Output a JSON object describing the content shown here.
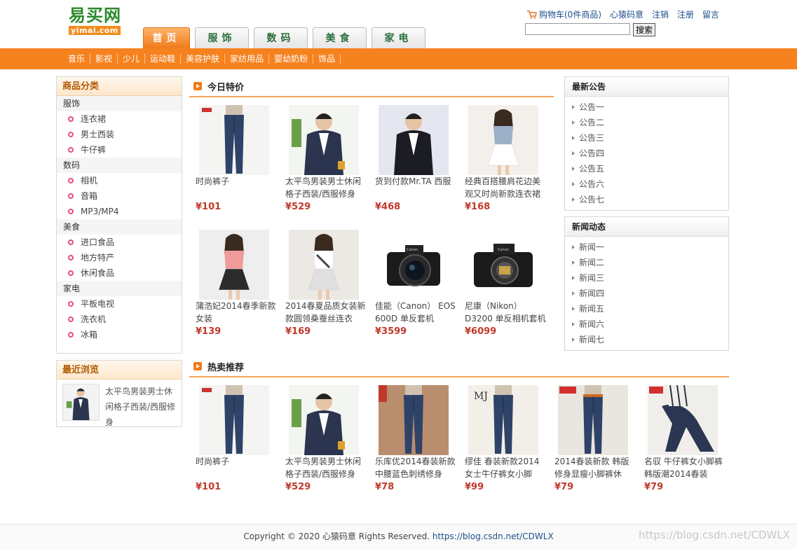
{
  "logo": {
    "cn": "易买网",
    "en": "yimai.com"
  },
  "top_links": {
    "cart": "购物车(0件商品)",
    "user": "心猿码意",
    "logout": "注销",
    "register": "注册",
    "message": "留言"
  },
  "search": {
    "button": "搜索",
    "placeholder": ""
  },
  "main_tabs": [
    "首页",
    "服饰",
    "数码",
    "美食",
    "家电"
  ],
  "subnav": [
    "音乐",
    "影视",
    "少儿",
    "运动鞋",
    "美容护肤",
    "家纺用品",
    "婴幼奶粉",
    "饰品"
  ],
  "categories": {
    "title": "商品分类",
    "groups": [
      {
        "name": "服饰",
        "items": [
          "连衣裙",
          "男士西装",
          "牛仔裤"
        ]
      },
      {
        "name": "数码",
        "items": [
          "相机",
          "音箱",
          "MP3/MP4"
        ]
      },
      {
        "name": "美食",
        "items": [
          "进口食品",
          "地方特产",
          "休闲食品"
        ]
      },
      {
        "name": "家电",
        "items": [
          "平板电视",
          "洗衣机",
          "冰箱"
        ]
      }
    ]
  },
  "recent": {
    "title": "最近浏览",
    "item": "太平鸟男装男士休闲格子西装/西服修身"
  },
  "specials": {
    "title": "今日特价",
    "products": [
      {
        "name": "时尚裤子",
        "price": "¥101",
        "img": "jeans"
      },
      {
        "name": "太平鸟男装男士休闲格子西装/西服修身",
        "price": "¥529",
        "img": "suit"
      },
      {
        "name": "货到付款Mr.TA 西服",
        "price": "¥468",
        "img": "suit-dark"
      },
      {
        "name": "经典百搭腰肩花边美观又时尚新款连衣裙",
        "price": "¥168",
        "img": "dress"
      },
      {
        "name": "蒲浩妃2014春季新款女装",
        "price": "¥139",
        "img": "woman-pink"
      },
      {
        "name": "2014春夏品质女装新款圆领桑蚕丝连衣",
        "price": "¥169",
        "img": "woman-white"
      },
      {
        "name": "佳能（Canon） EOS 600D 单反套机",
        "price": "¥3599",
        "img": "camera-lens"
      },
      {
        "name": "尼康（Nikon） D3200 单反相机套机",
        "price": "¥6099",
        "img": "camera-body"
      }
    ]
  },
  "hot": {
    "title": "热卖推荐",
    "products": [
      {
        "name": "时尚裤子",
        "price": "¥101",
        "img": "jeans"
      },
      {
        "name": "太平鸟男装男士休闲格子西装/西服修身",
        "price": "¥529",
        "img": "suit"
      },
      {
        "name": "乐库优2014春装新款中腰蓝色刺绣修身",
        "price": "¥78",
        "img": "jeans-brown"
      },
      {
        "name": "缪佳 春装新款2014女士牛仔裤女小脚",
        "price": "¥99",
        "img": "jeans-mj"
      },
      {
        "name": "2014春装新款 韩版修身显瘦小脚裤休",
        "price": "¥79",
        "img": "jeans-belt"
      },
      {
        "name": "名驭 牛仔裤女小脚裤韩版潮2014春装",
        "price": "¥79",
        "img": "jeans-sit"
      }
    ]
  },
  "announcements": {
    "title": "最新公告",
    "items": [
      "公告一",
      "公告二",
      "公告三",
      "公告四",
      "公告五",
      "公告六",
      "公告七"
    ]
  },
  "news": {
    "title": "新闻动态",
    "items": [
      "新闻一",
      "新闻二",
      "新闻三",
      "新闻四",
      "新闻五",
      "新闻六",
      "新闻七"
    ]
  },
  "footer": {
    "text": "Copyright © 2020 心猿码意 Rights Reserved.",
    "link": "https://blog.csdn.net/CDWLX"
  },
  "watermark": "https://blog.csdn.net/CDWLX",
  "colors": {
    "accent": "#f6821f",
    "price": "#c0392b",
    "link": "#1d4e8a"
  }
}
